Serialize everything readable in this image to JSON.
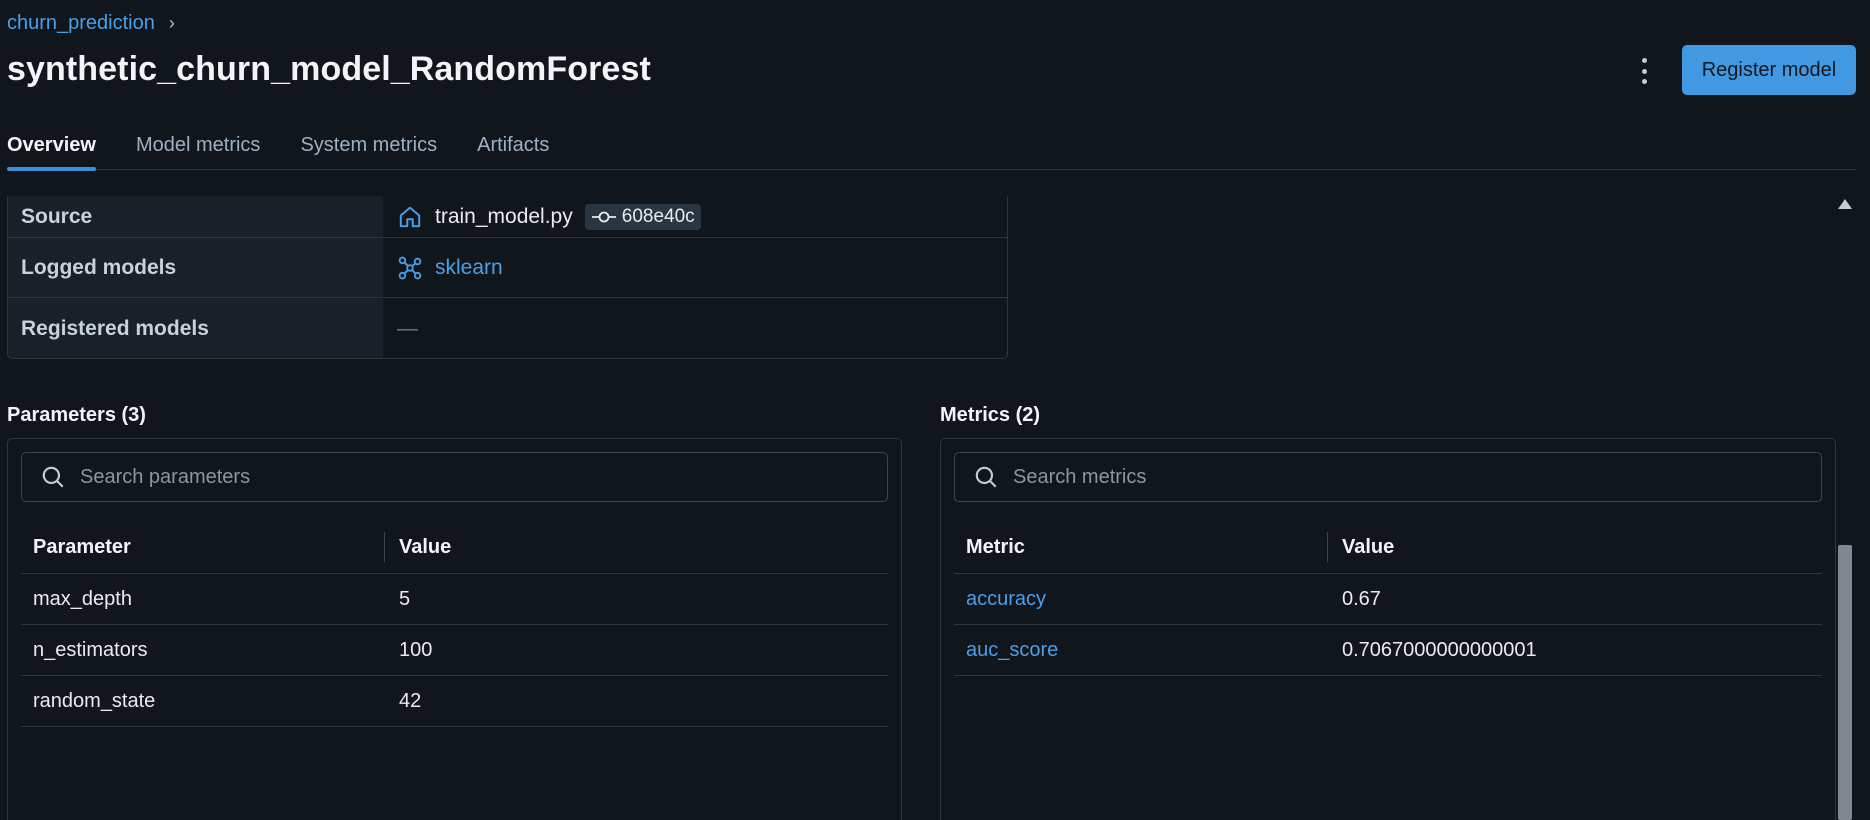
{
  "breadcrumb": {
    "experiment": "churn_prediction",
    "separator": "›"
  },
  "header": {
    "title": "synthetic_churn_model_RandomForest",
    "register_label": "Register model"
  },
  "tabs": [
    {
      "label": "Overview",
      "active": true
    },
    {
      "label": "Model metrics",
      "active": false
    },
    {
      "label": "System metrics",
      "active": false
    },
    {
      "label": "Artifacts",
      "active": false
    }
  ],
  "details": {
    "source": {
      "key": "Source",
      "file": "train_model.py",
      "commit": "608e40c",
      "icon": "home-icon"
    },
    "logged_models": {
      "key": "Logged models",
      "value": "sklearn",
      "icon": "model-graph-icon"
    },
    "registered_models": {
      "key": "Registered models",
      "value": "—"
    }
  },
  "parameters": {
    "title": "Parameters (3)",
    "search_placeholder": "Search parameters",
    "columns": [
      "Parameter",
      "Value"
    ],
    "rows": [
      {
        "name": "max_depth",
        "value": "5"
      },
      {
        "name": "n_estimators",
        "value": "100"
      },
      {
        "name": "random_state",
        "value": "42"
      }
    ]
  },
  "metrics": {
    "title": "Metrics (2)",
    "search_placeholder": "Search metrics",
    "columns": [
      "Metric",
      "Value"
    ],
    "rows": [
      {
        "name": "accuracy",
        "value": "0.67"
      },
      {
        "name": "auc_score",
        "value": "0.7067000000000001"
      }
    ]
  },
  "colors": {
    "background": "#11161d",
    "accent": "#4299e1",
    "link": "#4a9fe8",
    "border": "#2e3740"
  }
}
